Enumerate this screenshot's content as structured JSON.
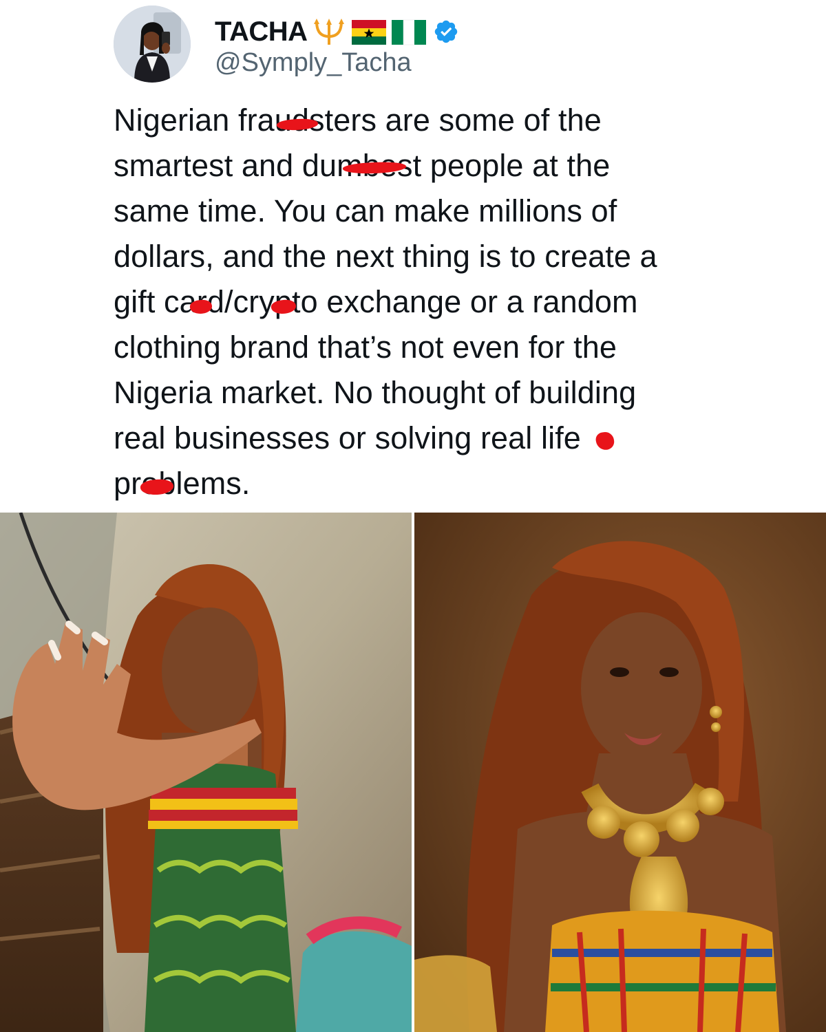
{
  "tweet": {
    "author": {
      "display_name": "TACHA",
      "handle": "@Symply_Tacha",
      "name_emojis": [
        "trident-emoji",
        "ghana-flag-emoji",
        "nigeria-flag-emoji"
      ],
      "verified": true
    },
    "text_lines": [
      "Nigerian fraudsters are some of the",
      "smartest and dumbest people at the",
      "same time. You can make millions of",
      "dollars, and the next thing is to create a",
      "gift card/crypto exchange or a random",
      "clothing brand that’s not even for the",
      "Nigeria market. No thought of building",
      "real businesses or solving real life",
      "problems."
    ]
  },
  "media": {
    "photos": [
      {
        "subject": "woman-raising-hand-photo"
      },
      {
        "subject": "woman-gold-necklace-portrait-photo"
      }
    ]
  },
  "colors": {
    "text": "#0f1419",
    "handle": "#536471",
    "verified": "#1d9bf0",
    "redaction": "#e8141a",
    "hair": "#8a3a14",
    "skin": "#7a4526"
  }
}
